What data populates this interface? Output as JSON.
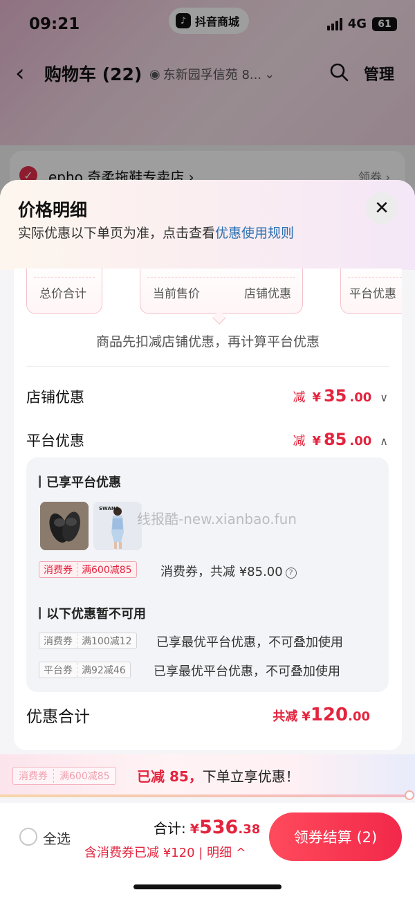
{
  "status_bar": {
    "time": "09:21",
    "app_pill": "抖音商城",
    "network": "4G",
    "battery": "61"
  },
  "nav": {
    "back": "‹",
    "title": "购物车 (22)",
    "address": "东新园孚信苑 8...",
    "manage": "管理"
  },
  "store": {
    "name": "epho 奇柔拖鞋专卖店 ›",
    "coupon": "领券 ›"
  },
  "sheet": {
    "title": "价格明细",
    "subtitle": "实际优惠以下单页为准，点击查看",
    "subtitle_link": "优惠使用规则",
    "summary": {
      "total_label": "总价合计",
      "current_label": "当前售价",
      "store_label": "店铺优惠",
      "platform_label": "平台优惠"
    },
    "note": "商品先扣减店铺优惠，再计算平台优惠",
    "store_row": {
      "label": "店铺优惠",
      "prefix": "减",
      "yen": "¥",
      "int": "35",
      "dec": ".00"
    },
    "platform_row": {
      "label": "平台优惠",
      "prefix": "减",
      "yen": "¥",
      "int": "85",
      "dec": ".00"
    },
    "enjoyed": {
      "title": "已享平台优惠",
      "coupon_type": "消费券",
      "coupon_rule": "满600减85",
      "coupon_text": "消费券，共减 ¥85.00",
      "product2_brand": "SWANS"
    },
    "unavailable": {
      "title": "以下优惠暂不可用",
      "items": [
        {
          "type": "消费券",
          "rule": "满100减12",
          "text": "已享最优平台优惠，不可叠加使用"
        },
        {
          "type": "平台券",
          "rule": "满92减46",
          "text": "已享最优平台优惠，不可叠加使用"
        }
      ]
    },
    "watermark": "线报酷-new.xianbao.fun",
    "total": {
      "label": "优惠合计",
      "prefix": "共减",
      "yen": "¥",
      "int": "120",
      "dec": ".00"
    }
  },
  "promo": {
    "tag_type": "消费券",
    "tag_rule": "满600减85",
    "highlight": "已减 85，",
    "text": "下单立享优惠！"
  },
  "bottom": {
    "select_all": "全选",
    "sum_label": "合计:",
    "sum_yen": "¥",
    "sum_int": "536",
    "sum_dec": ".38",
    "detail": "含消费券已减 ¥120 | 明细 ^",
    "checkout": "领券结算 (2)"
  },
  "colors": {
    "accent": "#e3243e",
    "link": "#2a6fb0",
    "checkout_start": "#ff4a5c",
    "checkout_end": "#f2284a"
  }
}
